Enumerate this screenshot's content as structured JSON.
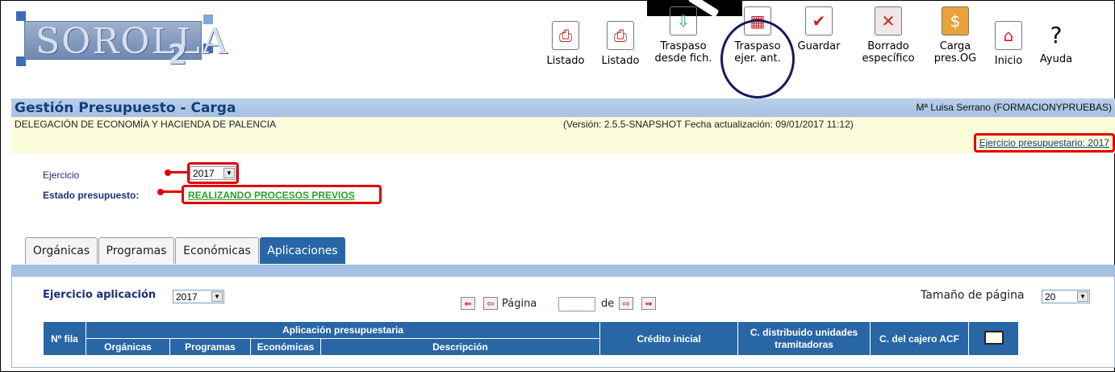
{
  "logo": {
    "text": "SOROLLA",
    "version": "2"
  },
  "toolbar": {
    "items": [
      {
        "label": "Listado",
        "icon": "pdf-report-icon"
      },
      {
        "label": "Listado",
        "icon": "pdf-report-icon"
      },
      {
        "label": "Traspaso\ndesde fich.",
        "icon": "import-file-icon"
      },
      {
        "label": "Traspaso\nejer. ant.",
        "icon": "transfer-previous-year-icon"
      },
      {
        "label": "Guardar",
        "icon": "save-check-icon"
      },
      {
        "label": "Borrado\nespecífico",
        "icon": "delete-x-icon"
      },
      {
        "label": "Carga\npres.OG",
        "icon": "load-budget-icon"
      },
      {
        "label": "Inicio",
        "icon": "home-icon"
      },
      {
        "label": "Ayuda",
        "icon": "help-icon"
      }
    ]
  },
  "header": {
    "title": "Gestión Presupuesto - Carga",
    "user": "Mª Luisa Serrano (FORMACIONYPRUEBAS)",
    "organization": "DELEGACIÓN DE ECONOMÍA Y HACIENDA DE PALENCIA",
    "version": "(Versión: 2.5.5-SNAPSHOT Fecha actualización: 09/01/2017 11:12)",
    "ejercicio_presupuestario": "Ejercicio presupuestario: 2017"
  },
  "form": {
    "ejercicio_label": "Ejercicio",
    "ejercicio_value": "2017",
    "estado_label": "Estado presupuesto:",
    "estado_value": "REALIZANDO PROCESOS PREVIOS"
  },
  "tabs": [
    {
      "label": "Orgánicas",
      "active": false
    },
    {
      "label": "Programas",
      "active": false
    },
    {
      "label": "Económicas",
      "active": false
    },
    {
      "label": "Aplicaciones",
      "active": true
    }
  ],
  "panel": {
    "ejercicio_aplicacion_label": "Ejercicio aplicación",
    "ejercicio_aplicacion_value": "2017",
    "pagina_label": "Página",
    "de_label": "de",
    "page_size_label": "Tamaño de página",
    "page_size_value": "20"
  },
  "table": {
    "nfila": "Nº fila",
    "aplicacion": "Aplicación presupuestaria",
    "organicas": "Orgánicas",
    "programas": "Programas",
    "economicas": "Económicas",
    "descripcion": "Descripción",
    "credito": "Crédito inicial",
    "distribuido": "C. distribuido unidades tramitadoras",
    "cajero": "C. del cajero ACF"
  },
  "colors": {
    "accent": "#2866a6",
    "title_bar": "#a6c1e4",
    "highlight": "#e10000",
    "status": "#2aa12a"
  }
}
